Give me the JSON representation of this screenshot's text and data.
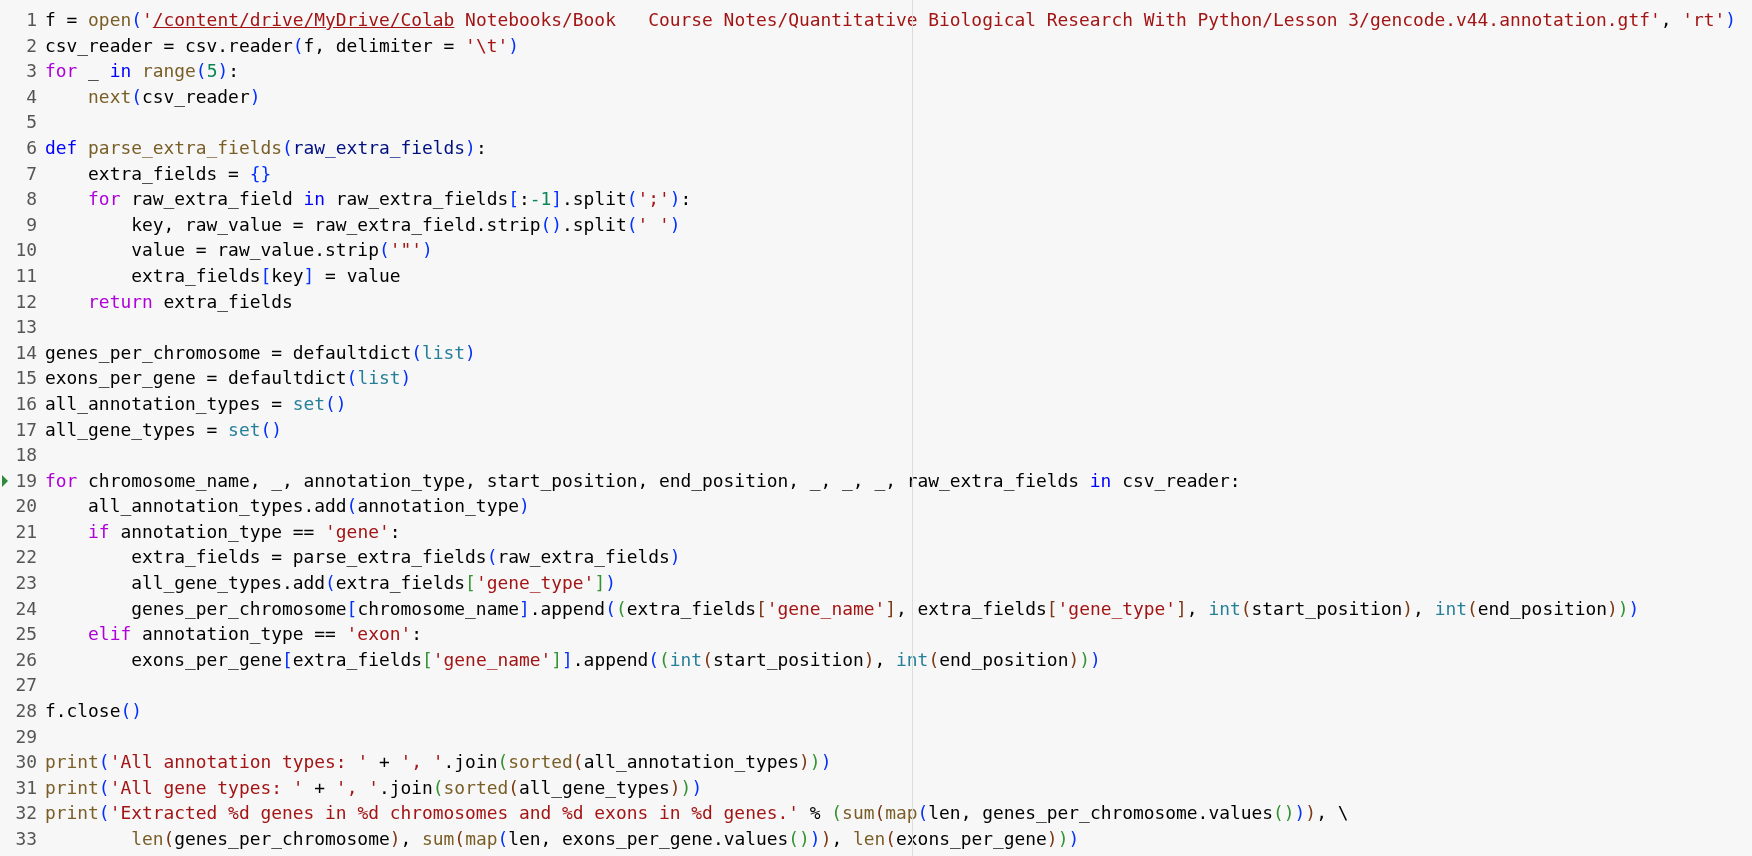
{
  "editor": {
    "lines": [
      {
        "number": "1",
        "marker": false,
        "tokens": [
          {
            "kind": "plain",
            "text": "f = "
          },
          {
            "kind": "function",
            "text": "open"
          },
          {
            "kind": "bracket1",
            "text": "("
          },
          {
            "kind": "string",
            "text": "'"
          },
          {
            "kind": "link",
            "text": "/content/drive/MyDrive/Colab"
          },
          {
            "kind": "string",
            "text": " Notebooks/Book   Course Notes/Quantitative Biological Research With Python/Lesson 3/gencode.v44.annotation.gtf'"
          },
          {
            "kind": "plain",
            "text": ", "
          },
          {
            "kind": "string",
            "text": "'rt'"
          },
          {
            "kind": "bracket1",
            "text": ")"
          }
        ]
      },
      {
        "number": "2",
        "marker": false,
        "tokens": [
          {
            "kind": "plain",
            "text": "csv_reader = csv.reader"
          },
          {
            "kind": "bracket1",
            "text": "("
          },
          {
            "kind": "plain",
            "text": "f, delimiter = "
          },
          {
            "kind": "string",
            "text": "'\\t'"
          },
          {
            "kind": "bracket1",
            "text": ")"
          }
        ]
      },
      {
        "number": "3",
        "marker": false,
        "tokens": [
          {
            "kind": "control",
            "text": "for"
          },
          {
            "kind": "plain",
            "text": " _ "
          },
          {
            "kind": "keyword",
            "text": "in "
          },
          {
            "kind": "function",
            "text": "range"
          },
          {
            "kind": "bracket1",
            "text": "("
          },
          {
            "kind": "number",
            "text": "5"
          },
          {
            "kind": "bracket1",
            "text": ")"
          },
          {
            "kind": "plain",
            "text": ":"
          }
        ]
      },
      {
        "number": "4",
        "marker": false,
        "tokens": [
          {
            "kind": "function",
            "text": "    next"
          },
          {
            "kind": "bracket1",
            "text": "("
          },
          {
            "kind": "plain",
            "text": "csv_reader"
          },
          {
            "kind": "bracket1",
            "text": ")"
          }
        ]
      },
      {
        "number": "5",
        "marker": false
      },
      {
        "number": "6",
        "marker": false,
        "tokens": [
          {
            "kind": "keyword",
            "text": "def "
          },
          {
            "kind": "function",
            "text": "parse_extra_fields"
          },
          {
            "kind": "bracket1",
            "text": "("
          },
          {
            "kind": "parameter",
            "text": "raw_extra_fields"
          },
          {
            "kind": "bracket1",
            "text": ")"
          },
          {
            "kind": "plain",
            "text": ":"
          }
        ]
      },
      {
        "number": "7",
        "marker": false,
        "tokens": [
          {
            "kind": "plain",
            "text": "    extra_fields = "
          },
          {
            "kind": "bracket1",
            "text": "{}"
          }
        ]
      },
      {
        "number": "8",
        "marker": false,
        "tokens": [
          {
            "kind": "control",
            "text": "    for"
          },
          {
            "kind": "plain",
            "text": " raw_extra_field "
          },
          {
            "kind": "keyword",
            "text": "in"
          },
          {
            "kind": "plain",
            "text": " raw_extra_fields"
          },
          {
            "kind": "bracket1",
            "text": "["
          },
          {
            "kind": "plain",
            "text": ":"
          },
          {
            "kind": "number",
            "text": "-1"
          },
          {
            "kind": "bracket1",
            "text": "]"
          },
          {
            "kind": "plain",
            "text": ".split"
          },
          {
            "kind": "bracket1",
            "text": "("
          },
          {
            "kind": "string",
            "text": "';'"
          },
          {
            "kind": "bracket1",
            "text": ")"
          },
          {
            "kind": "plain",
            "text": ":"
          }
        ]
      },
      {
        "number": "9",
        "marker": false,
        "tokens": [
          {
            "kind": "plain",
            "text": "        key, raw_value = raw_extra_field.strip"
          },
          {
            "kind": "bracket1",
            "text": "()"
          },
          {
            "kind": "plain",
            "text": ".split"
          },
          {
            "kind": "bracket1",
            "text": "("
          },
          {
            "kind": "string",
            "text": "' '"
          },
          {
            "kind": "bracket1",
            "text": ")"
          }
        ]
      },
      {
        "number": "10",
        "marker": false,
        "tokens": [
          {
            "kind": "plain",
            "text": "        value = raw_value.strip"
          },
          {
            "kind": "bracket1",
            "text": "("
          },
          {
            "kind": "string",
            "text": "'\"'"
          },
          {
            "kind": "bracket1",
            "text": ")"
          }
        ]
      },
      {
        "number": "11",
        "marker": false,
        "tokens": [
          {
            "kind": "plain",
            "text": "        extra_fields"
          },
          {
            "kind": "bracket1",
            "text": "["
          },
          {
            "kind": "plain",
            "text": "key"
          },
          {
            "kind": "bracket1",
            "text": "]"
          },
          {
            "kind": "plain",
            "text": " = value"
          }
        ]
      },
      {
        "number": "12",
        "marker": false,
        "tokens": [
          {
            "kind": "control",
            "text": "    return"
          },
          {
            "kind": "plain",
            "text": " extra_fields"
          }
        ]
      },
      {
        "number": "13",
        "marker": false
      },
      {
        "number": "14",
        "marker": false,
        "tokens": [
          {
            "kind": "plain",
            "text": "genes_per_chromosome = defaultdict"
          },
          {
            "kind": "bracket1",
            "text": "("
          },
          {
            "kind": "type",
            "text": "list"
          },
          {
            "kind": "bracket1",
            "text": ")"
          }
        ]
      },
      {
        "number": "15",
        "marker": false,
        "tokens": [
          {
            "kind": "plain",
            "text": "exons_per_gene = defaultdict"
          },
          {
            "kind": "bracket1",
            "text": "("
          },
          {
            "kind": "type",
            "text": "list"
          },
          {
            "kind": "bracket1",
            "text": ")"
          }
        ]
      },
      {
        "number": "16",
        "marker": false,
        "tokens": [
          {
            "kind": "plain",
            "text": "all_annotation_types = "
          },
          {
            "kind": "type",
            "text": "set"
          },
          {
            "kind": "bracket1",
            "text": "()"
          }
        ]
      },
      {
        "number": "17",
        "marker": false,
        "tokens": [
          {
            "kind": "plain",
            "text": "all_gene_types = "
          },
          {
            "kind": "type",
            "text": "set"
          },
          {
            "kind": "bracket1",
            "text": "()"
          }
        ]
      },
      {
        "number": "18",
        "marker": false
      },
      {
        "number": "19",
        "marker": true,
        "tokens": [
          {
            "kind": "control",
            "text": "for"
          },
          {
            "kind": "plain",
            "text": " chromosome_name, _, annotation_type, start_position, end_position, _, _, _, raw_extra_fields "
          },
          {
            "kind": "keyword",
            "text": "in"
          },
          {
            "kind": "plain",
            "text": " csv_reader:"
          }
        ]
      },
      {
        "number": "20",
        "marker": false,
        "tokens": [
          {
            "kind": "plain",
            "text": "    all_annotation_types.add"
          },
          {
            "kind": "bracket1",
            "text": "("
          },
          {
            "kind": "plain",
            "text": "annotation_type"
          },
          {
            "kind": "bracket1",
            "text": ")"
          }
        ]
      },
      {
        "number": "21",
        "marker": false,
        "tokens": [
          {
            "kind": "control",
            "text": "    if"
          },
          {
            "kind": "plain",
            "text": " annotation_type == "
          },
          {
            "kind": "string",
            "text": "'gene'"
          },
          {
            "kind": "plain",
            "text": ":"
          }
        ]
      },
      {
        "number": "22",
        "marker": false,
        "tokens": [
          {
            "kind": "plain",
            "text": "        extra_fields = parse_extra_fields"
          },
          {
            "kind": "bracket1",
            "text": "("
          },
          {
            "kind": "plain",
            "text": "raw_extra_fields"
          },
          {
            "kind": "bracket1",
            "text": ")"
          }
        ]
      },
      {
        "number": "23",
        "marker": false,
        "tokens": [
          {
            "kind": "plain",
            "text": "        all_gene_types.add"
          },
          {
            "kind": "bracket1",
            "text": "("
          },
          {
            "kind": "plain",
            "text": "extra_fields"
          },
          {
            "kind": "bracket2",
            "text": "["
          },
          {
            "kind": "string",
            "text": "'gene_type'"
          },
          {
            "kind": "bracket2",
            "text": "]"
          },
          {
            "kind": "bracket1",
            "text": ")"
          }
        ]
      },
      {
        "number": "24",
        "marker": false,
        "tokens": [
          {
            "kind": "plain",
            "text": "        genes_per_chromosome"
          },
          {
            "kind": "bracket1",
            "text": "["
          },
          {
            "kind": "plain",
            "text": "chromosome_name"
          },
          {
            "kind": "bracket1",
            "text": "]"
          },
          {
            "kind": "plain",
            "text": ".append"
          },
          {
            "kind": "bracket1",
            "text": "("
          },
          {
            "kind": "bracket2",
            "text": "("
          },
          {
            "kind": "plain",
            "text": "extra_fields"
          },
          {
            "kind": "bracket3",
            "text": "["
          },
          {
            "kind": "string",
            "text": "'gene_name'"
          },
          {
            "kind": "bracket3",
            "text": "]"
          },
          {
            "kind": "plain",
            "text": ", extra_fields"
          },
          {
            "kind": "bracket3",
            "text": "["
          },
          {
            "kind": "string",
            "text": "'gene_type'"
          },
          {
            "kind": "bracket3",
            "text": "]"
          },
          {
            "kind": "plain",
            "text": ", "
          },
          {
            "kind": "type",
            "text": "int"
          },
          {
            "kind": "bracket3",
            "text": "("
          },
          {
            "kind": "plain",
            "text": "start_position"
          },
          {
            "kind": "bracket3",
            "text": ")"
          },
          {
            "kind": "plain",
            "text": ", "
          },
          {
            "kind": "type",
            "text": "int"
          },
          {
            "kind": "bracket3",
            "text": "("
          },
          {
            "kind": "plain",
            "text": "end_position"
          },
          {
            "kind": "bracket3",
            "text": ")"
          },
          {
            "kind": "bracket2",
            "text": ")"
          },
          {
            "kind": "bracket1",
            "text": ")"
          }
        ]
      },
      {
        "number": "25",
        "marker": false,
        "tokens": [
          {
            "kind": "control",
            "text": "    elif"
          },
          {
            "kind": "plain",
            "text": " annotation_type == "
          },
          {
            "kind": "string",
            "text": "'exon'"
          },
          {
            "kind": "plain",
            "text": ":"
          }
        ]
      },
      {
        "number": "26",
        "marker": false,
        "tokens": [
          {
            "kind": "plain",
            "text": "        exons_per_gene"
          },
          {
            "kind": "bracket1",
            "text": "["
          },
          {
            "kind": "plain",
            "text": "extra_fields"
          },
          {
            "kind": "bracket2",
            "text": "["
          },
          {
            "kind": "string",
            "text": "'gene_name'"
          },
          {
            "kind": "bracket2",
            "text": "]"
          },
          {
            "kind": "bracket1",
            "text": "]"
          },
          {
            "kind": "plain",
            "text": ".append"
          },
          {
            "kind": "bracket1",
            "text": "("
          },
          {
            "kind": "bracket2",
            "text": "("
          },
          {
            "kind": "type",
            "text": "int"
          },
          {
            "kind": "bracket3",
            "text": "("
          },
          {
            "kind": "plain",
            "text": "start_position"
          },
          {
            "kind": "bracket3",
            "text": ")"
          },
          {
            "kind": "plain",
            "text": ", "
          },
          {
            "kind": "type",
            "text": "int"
          },
          {
            "kind": "bracket3",
            "text": "("
          },
          {
            "kind": "plain",
            "text": "end_position"
          },
          {
            "kind": "bracket3",
            "text": ")"
          },
          {
            "kind": "bracket2",
            "text": ")"
          },
          {
            "kind": "bracket1",
            "text": ")"
          }
        ]
      },
      {
        "number": "27",
        "marker": false
      },
      {
        "number": "28",
        "marker": false,
        "tokens": [
          {
            "kind": "plain",
            "text": "f.close"
          },
          {
            "kind": "bracket1",
            "text": "()"
          }
        ]
      },
      {
        "number": "29",
        "marker": false
      },
      {
        "number": "30",
        "marker": false,
        "tokens": [
          {
            "kind": "function",
            "text": "print"
          },
          {
            "kind": "bracket1",
            "text": "("
          },
          {
            "kind": "string",
            "text": "'All annotation types: '"
          },
          {
            "kind": "plain",
            "text": " + "
          },
          {
            "kind": "string",
            "text": "', '"
          },
          {
            "kind": "plain",
            "text": ".join"
          },
          {
            "kind": "bracket2",
            "text": "("
          },
          {
            "kind": "function",
            "text": "sorted"
          },
          {
            "kind": "bracket3",
            "text": "("
          },
          {
            "kind": "plain",
            "text": "all_annotation_types"
          },
          {
            "kind": "bracket3",
            "text": ")"
          },
          {
            "kind": "bracket2",
            "text": ")"
          },
          {
            "kind": "bracket1",
            "text": ")"
          }
        ]
      },
      {
        "number": "31",
        "marker": false,
        "tokens": [
          {
            "kind": "function",
            "text": "print"
          },
          {
            "kind": "bracket1",
            "text": "("
          },
          {
            "kind": "string",
            "text": "'All gene types: '"
          },
          {
            "kind": "plain",
            "text": " + "
          },
          {
            "kind": "string",
            "text": "', '"
          },
          {
            "kind": "plain",
            "text": ".join"
          },
          {
            "kind": "bracket2",
            "text": "("
          },
          {
            "kind": "function",
            "text": "sorted"
          },
          {
            "kind": "bracket3",
            "text": "("
          },
          {
            "kind": "plain",
            "text": "all_gene_types"
          },
          {
            "kind": "bracket3",
            "text": ")"
          },
          {
            "kind": "bracket2",
            "text": ")"
          },
          {
            "kind": "bracket1",
            "text": ")"
          }
        ]
      },
      {
        "number": "32",
        "marker": false,
        "tokens": [
          {
            "kind": "function",
            "text": "print"
          },
          {
            "kind": "bracket1",
            "text": "("
          },
          {
            "kind": "string",
            "text": "'Extracted %d genes in %d chromosomes and %d exons in %d genes.'"
          },
          {
            "kind": "plain",
            "text": " % "
          },
          {
            "kind": "bracket2",
            "text": "("
          },
          {
            "kind": "function",
            "text": "sum"
          },
          {
            "kind": "bracket3",
            "text": "("
          },
          {
            "kind": "function",
            "text": "map"
          },
          {
            "kind": "bracket1",
            "text": "("
          },
          {
            "kind": "plain",
            "text": "len, genes_per_chromosome.values"
          },
          {
            "kind": "bracket2",
            "text": "()"
          },
          {
            "kind": "bracket1",
            "text": ")"
          },
          {
            "kind": "bracket3",
            "text": ")"
          },
          {
            "kind": "plain",
            "text": ", \\"
          }
        ]
      },
      {
        "number": "33",
        "marker": false,
        "tokens": [
          {
            "kind": "function",
            "text": "        len"
          },
          {
            "kind": "bracket3",
            "text": "("
          },
          {
            "kind": "plain",
            "text": "genes_per_chromosome"
          },
          {
            "kind": "bracket3",
            "text": ")"
          },
          {
            "kind": "plain",
            "text": ", "
          },
          {
            "kind": "function",
            "text": "sum"
          },
          {
            "kind": "bracket3",
            "text": "("
          },
          {
            "kind": "function",
            "text": "map"
          },
          {
            "kind": "bracket1",
            "text": "("
          },
          {
            "kind": "plain",
            "text": "len, exons_per_gene.values"
          },
          {
            "kind": "bracket2",
            "text": "()"
          },
          {
            "kind": "bracket1",
            "text": ")"
          },
          {
            "kind": "bracket3",
            "text": ")"
          },
          {
            "kind": "plain",
            "text": ", "
          },
          {
            "kind": "function",
            "text": "len"
          },
          {
            "kind": "bracket3",
            "text": "("
          },
          {
            "kind": "plain",
            "text": "exons_per_gene"
          },
          {
            "kind": "bracket3",
            "text": ")"
          },
          {
            "kind": "bracket2",
            "text": ")"
          },
          {
            "kind": "bracket1",
            "text": ")"
          }
        ]
      }
    ]
  }
}
